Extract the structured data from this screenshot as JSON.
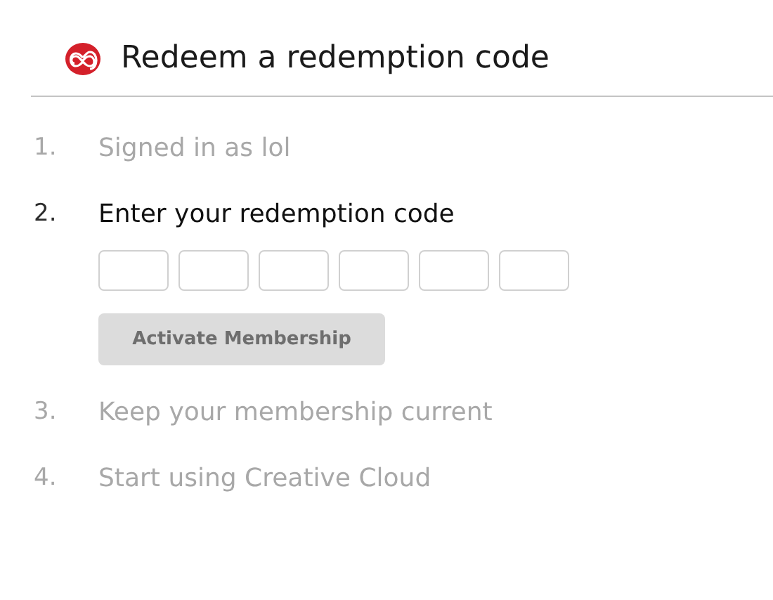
{
  "header": {
    "title": "Redeem a redemption code"
  },
  "steps": [
    {
      "number": "1.",
      "label": "Signed in as lol",
      "active": false
    },
    {
      "number": "2.",
      "label": "Enter your redemption code",
      "active": true,
      "code_fields": [
        {
          "disabled": false
        },
        {
          "disabled": false
        },
        {
          "disabled": false
        },
        {
          "disabled": false
        },
        {
          "disabled": false
        },
        {
          "disabled": false
        }
      ],
      "button": {
        "label": "Activate Membership",
        "disabled": true
      }
    },
    {
      "number": "3.",
      "label": "Keep your membership current",
      "active": false
    },
    {
      "number": "4.",
      "label": "Start using Creative Cloud",
      "active": false
    }
  ]
}
